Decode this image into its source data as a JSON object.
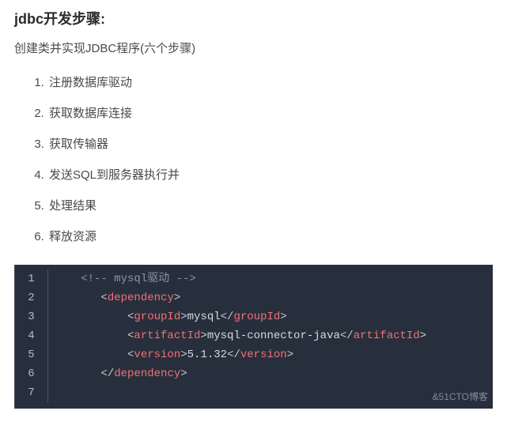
{
  "heading": "jdbc开发步骤:",
  "subtitle": "创建类并实现JDBC程序(六个步骤)",
  "steps": [
    "注册数据库驱动",
    "获取数据库连接",
    "获取传输器",
    "发送SQL到服务器执行并",
    "处理结果",
    "释放资源"
  ],
  "code": {
    "lines": [
      {
        "n": "1",
        "indent": "   ",
        "kind": "comment",
        "text": "<!-- mysql驱动 -->"
      },
      {
        "n": "2",
        "indent": "      ",
        "kind": "open",
        "tag": "dependency"
      },
      {
        "n": "3",
        "indent": "          ",
        "kind": "pair",
        "tag": "groupId",
        "text": "mysql"
      },
      {
        "n": "4",
        "indent": "          ",
        "kind": "pair",
        "tag": "artifactId",
        "text": "mysql-connector-java"
      },
      {
        "n": "5",
        "indent": "          ",
        "kind": "pair",
        "tag": "version",
        "text": "5.1.32"
      },
      {
        "n": "6",
        "indent": "      ",
        "kind": "close",
        "tag": "dependency"
      },
      {
        "n": "7",
        "indent": "",
        "kind": "blank"
      }
    ]
  },
  "watermark": "&51CTO博客"
}
